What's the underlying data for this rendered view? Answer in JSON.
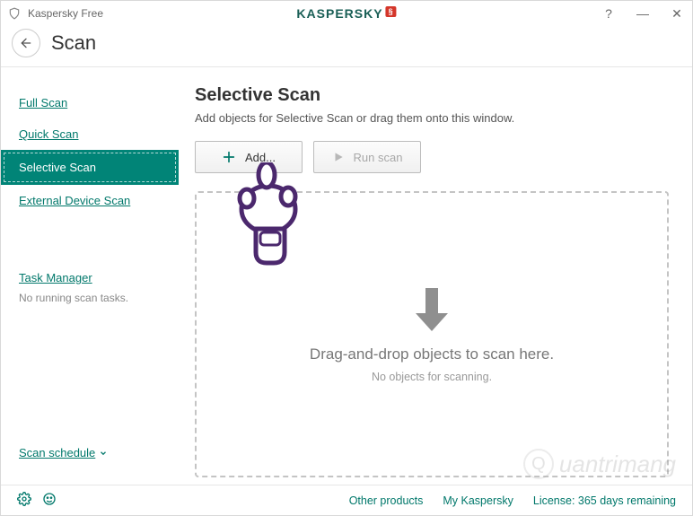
{
  "app": {
    "name": "Kaspersky Free",
    "brand": "KASPERSKY",
    "brand_suffix": "§"
  },
  "win_controls": {
    "help": "?",
    "minimize": "—",
    "close": "✕"
  },
  "header": {
    "page_title": "Scan"
  },
  "sidebar": {
    "items": [
      {
        "label": "Full Scan"
      },
      {
        "label": "Quick Scan"
      },
      {
        "label": "Selective Scan",
        "active": true
      },
      {
        "label": "External Device Scan"
      }
    ],
    "task_manager": {
      "label": "Task Manager",
      "status": "No running scan tasks."
    },
    "schedule": {
      "label": "Scan schedule"
    }
  },
  "main": {
    "heading": "Selective Scan",
    "description": "Add objects for Selective Scan or drag them onto this window.",
    "buttons": {
      "add": "Add...",
      "run": "Run scan"
    },
    "dropzone": {
      "title": "Drag-and-drop objects to scan here.",
      "subtitle": "No objects for scanning."
    }
  },
  "footer": {
    "other_products": "Other products",
    "my_account": "My Kaspersky",
    "license": "License: 365 days remaining"
  },
  "watermark": {
    "text": "uantrimang"
  }
}
